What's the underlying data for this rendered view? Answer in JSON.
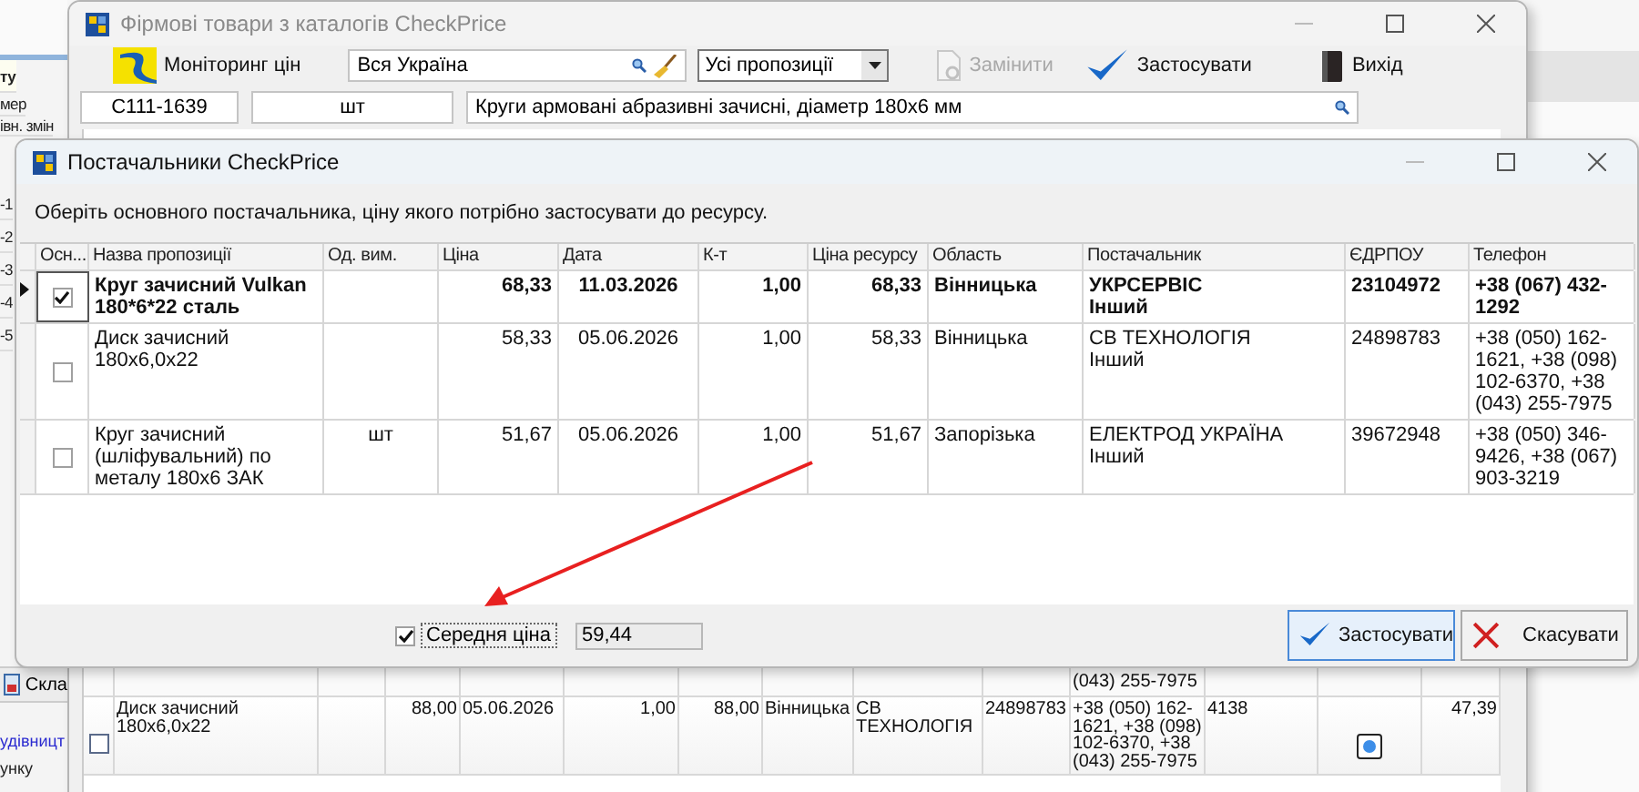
{
  "base_app": {
    "left_labels": [
      "ту",
      "мер",
      "івн. змін",
      "-1",
      "-2",
      "-3",
      "-4",
      "-5"
    ],
    "bottom_button": "Скла",
    "link": "удівницт",
    "bottom_text": "унку"
  },
  "catalog_window": {
    "title": "Фірмові товари з каталогів CheckPrice",
    "toolbar": [
      {
        "kind": "monitor",
        "label": "Моніторинг цін",
        "disabled": false
      },
      {
        "kind": "region",
        "value": "Вся Україна"
      },
      {
        "kind": "select",
        "value": "Усі пропозиції"
      },
      {
        "kind": "replace",
        "label": "Замінити",
        "disabled": true
      },
      {
        "kind": "apply",
        "label": "Застосувати",
        "disabled": false
      },
      {
        "kind": "exit",
        "label": "Вихід",
        "disabled": false
      }
    ],
    "code": "С111-1639",
    "unit": "шт",
    "description": "Круги армовані абразивні зачисні, діаметр 180х6 мм",
    "table": {
      "partial_phone": "(043) 255-7975",
      "rows": [
        {
          "checked": false,
          "name": "Диск зачисний 180х6,0х22",
          "price": "88,00",
          "date": "05.06.2026",
          "coefficient": "1,00",
          "resource_price": "88,00",
          "region": "Вінницька",
          "supplier": "СВ ТЕХНОЛОГІЯ",
          "edrpou": "24898783",
          "phone": "+38 (050) 162-1621, +38 (098) 102-6370, +38 (043) 255-7975",
          "column_12": "4138",
          "column_14": "47,39"
        }
      ]
    }
  },
  "dialog": {
    "title": "Постачальники CheckPrice",
    "instruction": "Оберіть основного постачальника, ціну якого потрібно застосувати до ресурсу.",
    "columns": [
      {
        "kind": "check",
        "label": "Осн..."
      },
      {
        "kind": "name",
        "label": "Назва пропозиції"
      },
      {
        "kind": "unit",
        "label": "Од. вим."
      },
      {
        "kind": "price",
        "label": "Ціна"
      },
      {
        "kind": "date",
        "label": "Дата"
      },
      {
        "kind": "coefficient",
        "label": "К-т"
      },
      {
        "kind": "resource_price",
        "label": "Ціна ресурсу"
      },
      {
        "kind": "region",
        "label": "Область"
      },
      {
        "kind": "supplier",
        "label": "Постачальник"
      },
      {
        "kind": "edrpou",
        "label": "ЄДРПОУ"
      },
      {
        "kind": "phone",
        "label": "Телефон"
      }
    ],
    "rows": [
      {
        "selected": true,
        "checked": true,
        "name": "Круг зачисний Vulkan 180*6*22 сталь",
        "price": "68,33",
        "date": "11.03.2026",
        "coefficient": "1,00",
        "resource_price": "68,33",
        "region": "Вінницька",
        "supplier": "УКРСЕРВІС",
        "supplier_type": "Інший",
        "edrpou": "23104972",
        "phone": "+38 (067) 432-1292"
      },
      {
        "selected": false,
        "checked": false,
        "name": "Диск зачисний 180х6,0х22",
        "price": "58,33",
        "date": "05.06.2026",
        "coefficient": "1,00",
        "resource_price": "58,33",
        "region": "Вінницька",
        "supplier": "СВ ТЕХНОЛОГІЯ",
        "supplier_type": "Інший",
        "edrpou": "24898783",
        "phone": "+38 (050) 162-1621, +38 (098) 102-6370, +38 (043) 255-7975"
      },
      {
        "selected": false,
        "checked": false,
        "name": "Круг зачисний (шліфувальний) по металу 180х6 ЗАК",
        "unit": "шт",
        "price": "51,67",
        "date": "05.06.2026",
        "coefficient": "1,00",
        "resource_price": "51,67",
        "region": "Запорізька",
        "supplier": "ЕЛЕКТРОД УКРАЇНА",
        "supplier_type": "Інший",
        "edrpou": "39672948",
        "phone": "+38 (050) 346-9426, +38 (067) 903-3219"
      }
    ],
    "average": {
      "checked": true,
      "label": "Середня ціна",
      "value": "59,44"
    },
    "buttons": [
      {
        "kind": "apply",
        "label": "Застосувати"
      },
      {
        "kind": "cancel",
        "label": "Скасувати"
      }
    ]
  }
}
